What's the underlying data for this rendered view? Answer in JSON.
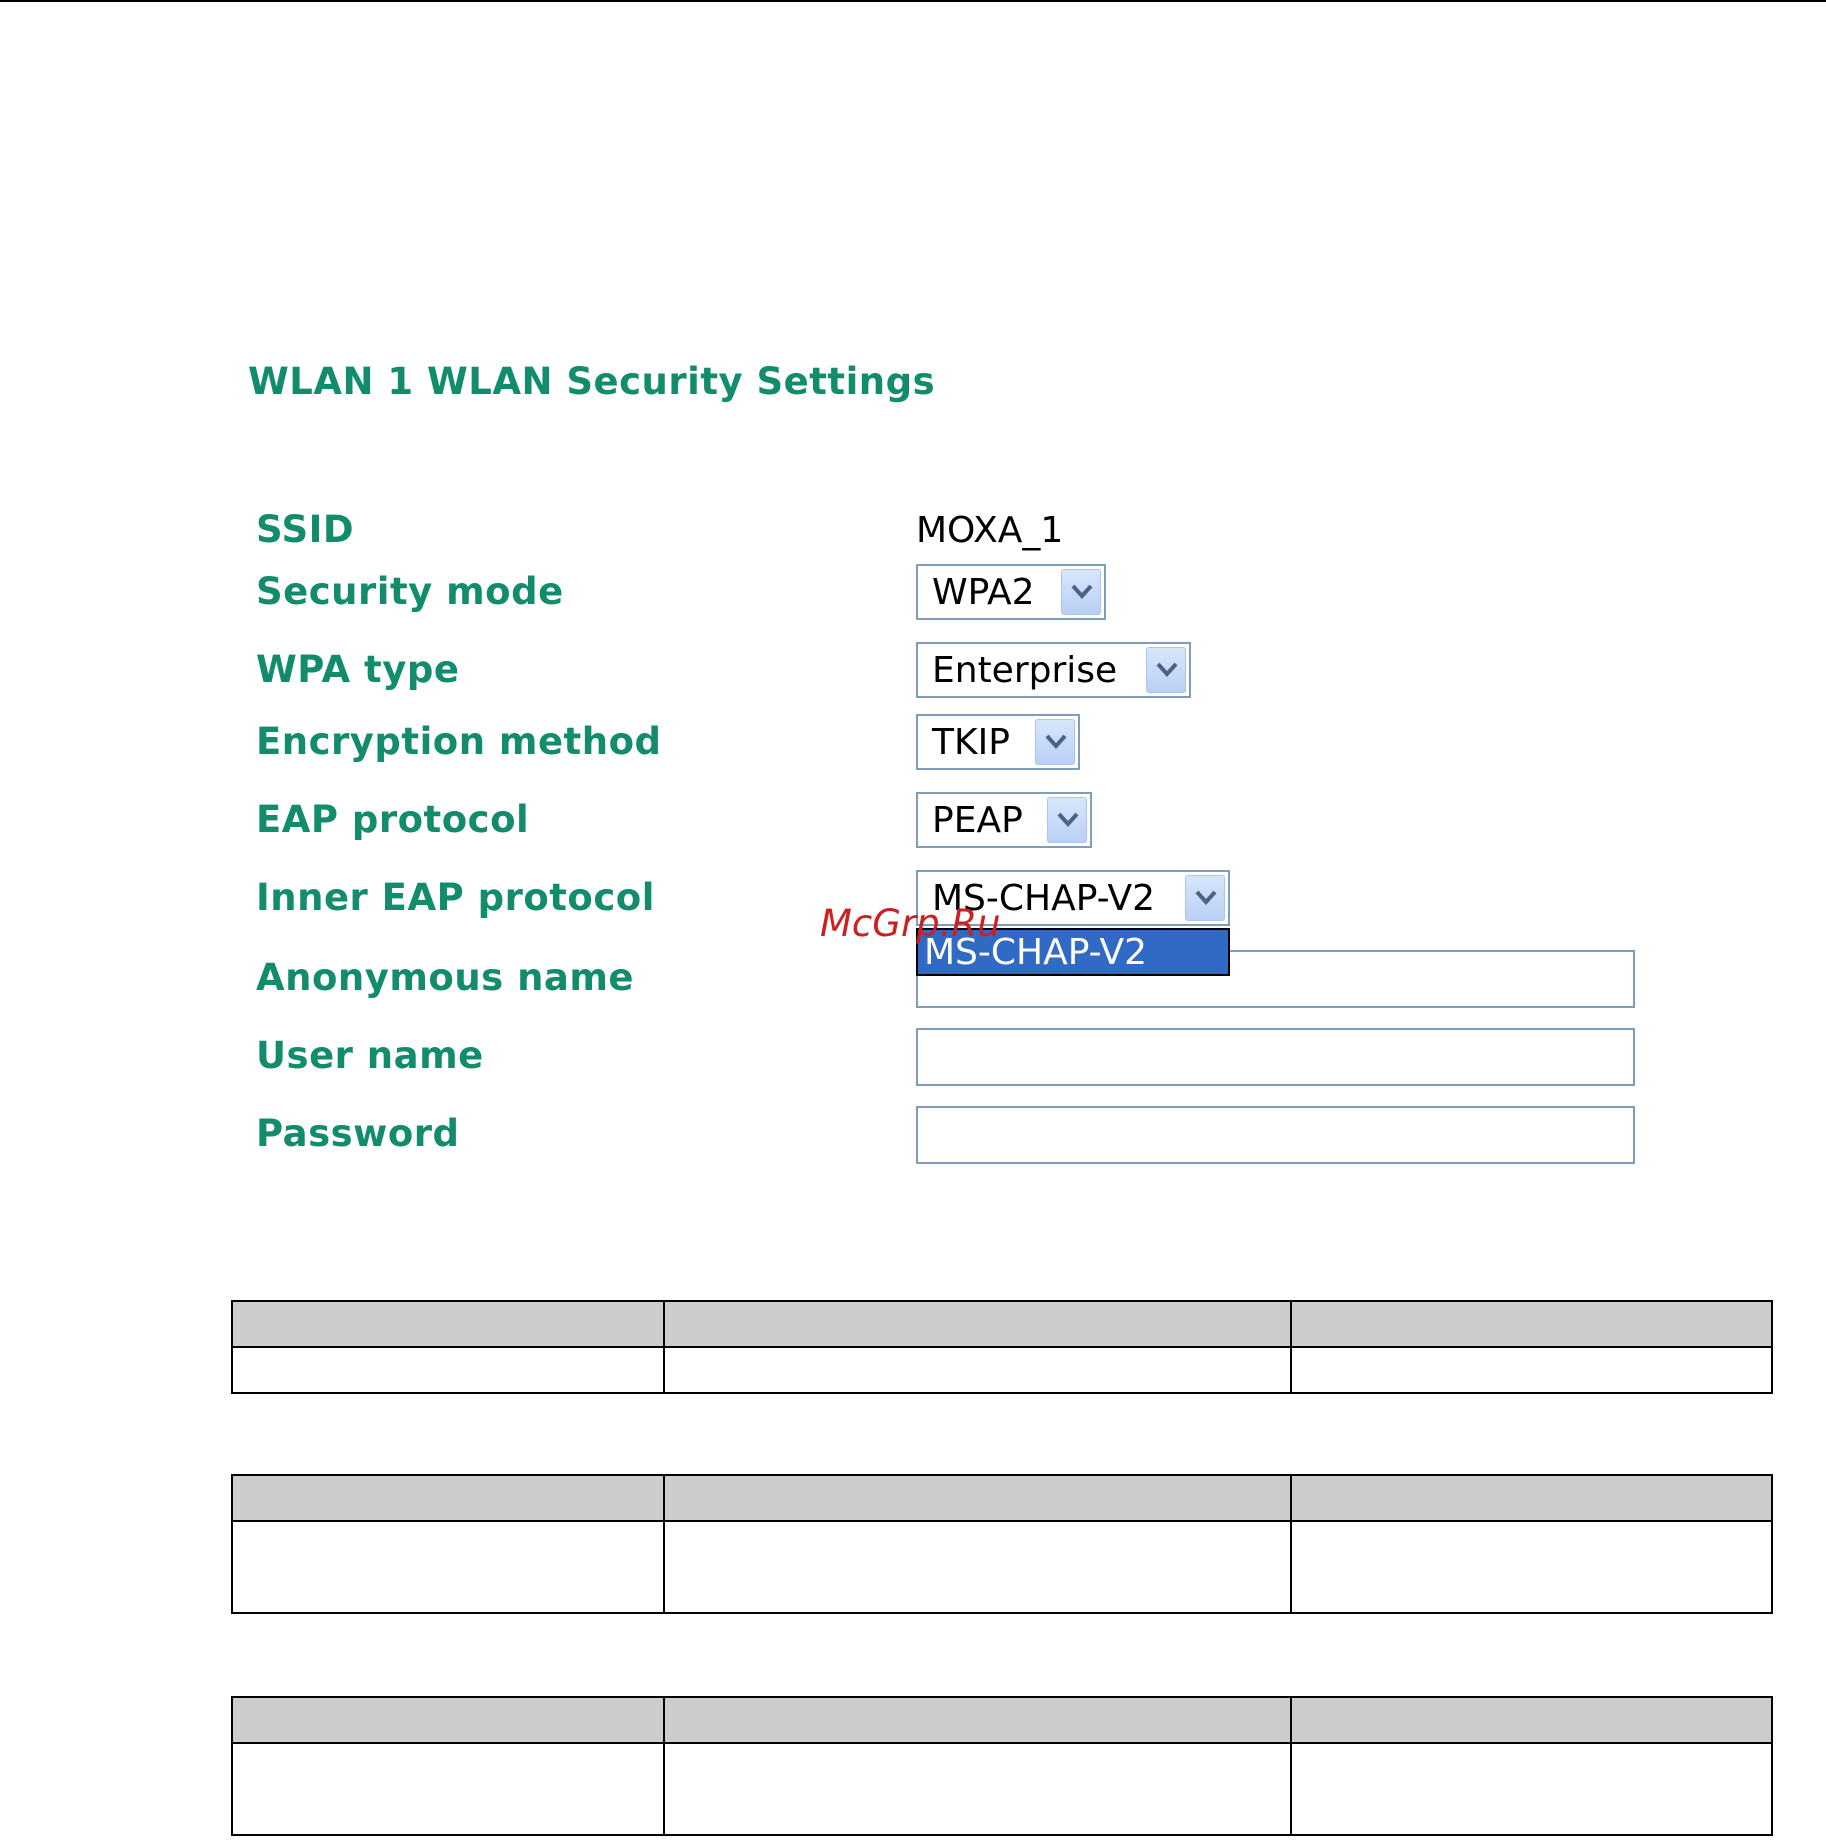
{
  "panel": {
    "title": "WLAN 1  WLAN Security Settings"
  },
  "fields": {
    "ssid": {
      "label": "SSID",
      "value": "MOXA_1"
    },
    "security_mode": {
      "label": "Security mode",
      "value": "WPA2"
    },
    "wpa_type": {
      "label": "WPA type",
      "value": "Enterprise"
    },
    "encryption_method": {
      "label": "Encryption method",
      "value": "TKIP"
    },
    "eap_protocol": {
      "label": "EAP protocol",
      "value": "PEAP"
    },
    "inner_eap_protocol": {
      "label": "Inner EAP protocol",
      "value": "MS-CHAP-V2",
      "options": [
        "MS-CHAP-V2"
      ]
    },
    "anonymous_name": {
      "label": "Anonymous name",
      "value": ""
    },
    "user_name": {
      "label": "User name",
      "value": ""
    },
    "password": {
      "label": "Password",
      "value": ""
    }
  },
  "watermark": "McGrp.Ru",
  "colors": {
    "label_green": "#138c6e",
    "select_border": "#7f9db9",
    "highlight_blue": "#316ac5",
    "table_header_gray": "#cccccc",
    "watermark_red": "#cc1f1f"
  }
}
